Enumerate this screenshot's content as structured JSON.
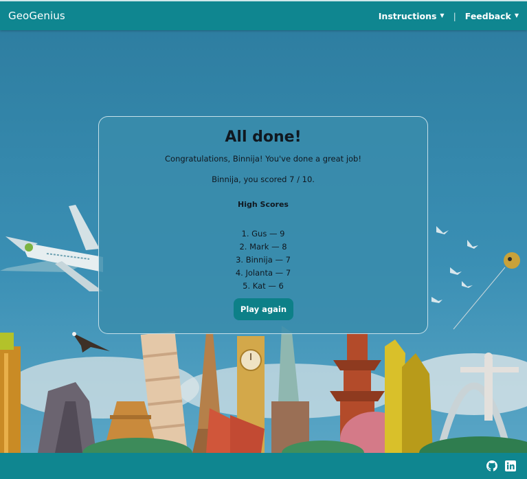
{
  "navbar": {
    "brand": "GeoGenius",
    "instructions_label": "Instructions",
    "feedback_label": "Feedback",
    "separator": "|",
    "caret_icon": "chevron-down-icon"
  },
  "modal": {
    "title": "All done!",
    "message": "Congratulations, Binnija! You've done a great job!",
    "score_text": "Binnija, you scored 7 / 10.",
    "high_scores_title": "High Scores",
    "high_scores": [
      "1. Gus — 9",
      "2. Mark — 8",
      "3. Binnija — 7",
      "4. Jolanta — 7",
      "5. Kat — 6"
    ],
    "play_again_label": "Play again"
  },
  "footer": {
    "icons": [
      "github-icon",
      "linkedin-icon"
    ]
  },
  "colors": {
    "navbar": "#0f8690",
    "button": "#0d8088",
    "sky": "#2f7fa3"
  }
}
